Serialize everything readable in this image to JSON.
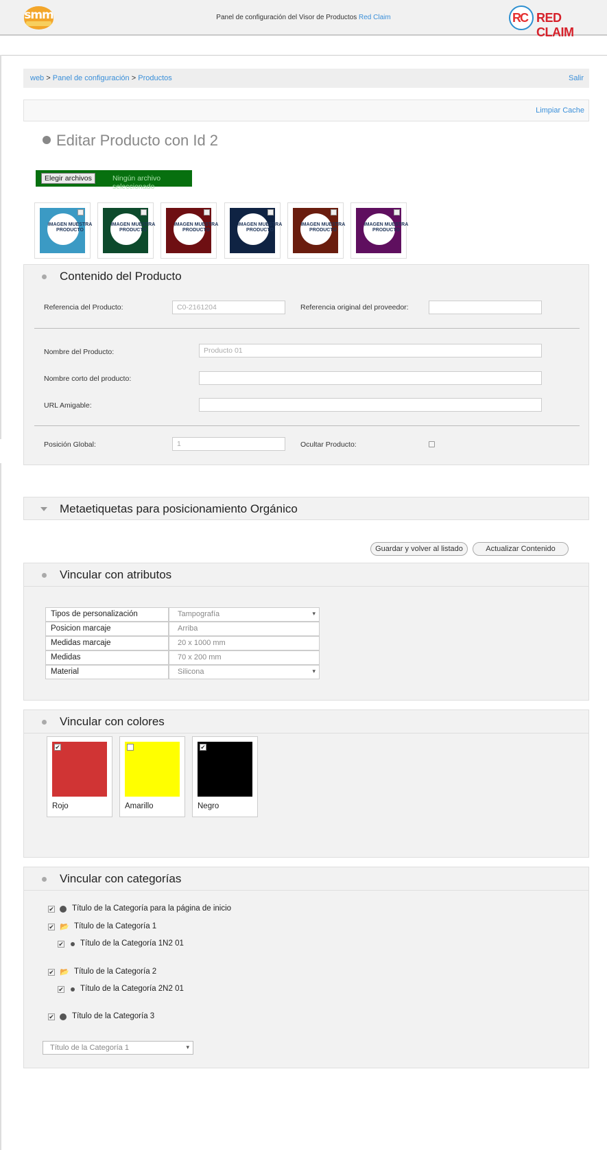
{
  "header": {
    "left_logo": "smm",
    "title_prefix": "Panel de configuración del Visor de Productos",
    "title_link": "Red Claim",
    "right_logo_text": "RED CLAIM"
  },
  "breadcrumb": {
    "items": [
      "web",
      "Panel de configuración",
      "Productos"
    ],
    "separator": ">",
    "logout": "Salir"
  },
  "cache": {
    "label": "Limpiar Cache"
  },
  "page": {
    "title": "Editar Producto con Id 2"
  },
  "file": {
    "button": "Elegir archivos",
    "status": "Ningún archivo seleccionado"
  },
  "thumbnails": [
    {
      "caption": "IMAGEN MUESTRA PRODUCTO",
      "color": "#3b9ac4"
    },
    {
      "caption": "IMAGEN MUESTRA PRODUCTO",
      "color": "#0d4a2c"
    },
    {
      "caption": "IMAGEN MUESTRA PRODUCTO",
      "color": "#6e0f12"
    },
    {
      "caption": "IMAGEN MUESTRA PRODUCTO",
      "color": "#0f2343"
    },
    {
      "caption": "IMAGEN MUESTRA PRODUCTO",
      "color": "#6a1d0e"
    },
    {
      "caption": "IMAGEN MUESTRA PRODUCTO",
      "color": "#5f0f5f"
    }
  ],
  "content": {
    "heading": "Contenido del Producto",
    "ref_label": "Referencia del Producto:",
    "ref_value": "C0-2161204",
    "orig_ref_label": "Referencia original del proveedor:",
    "orig_ref_value": "",
    "name_label": "Nombre del Producto:",
    "name_value": "Producto 01",
    "short_name_label": "Nombre corto del producto:",
    "short_name_value": "",
    "url_label": "URL Amigable:",
    "url_value": "",
    "position_label": "Posición Global:",
    "position_value": "1",
    "hide_label": "Ocultar Producto:"
  },
  "meta": {
    "heading": "Metaetiquetas para posicionamiento Orgánico"
  },
  "actions": {
    "save_back": "Guardar y volver al listado",
    "update": "Actualizar Contenido"
  },
  "attributes": {
    "heading": "Vincular con atributos",
    "rows": [
      {
        "key": "Tipos de personalización",
        "value": "Tampografía",
        "select": true
      },
      {
        "key": "Posicion marcaje",
        "value": "Arriba",
        "select": false
      },
      {
        "key": "Medidas marcaje",
        "value": "20 x 1000 mm",
        "select": false
      },
      {
        "key": "Medidas",
        "value": "70 x 200 mm",
        "select": false
      },
      {
        "key": "Material",
        "value": "Silicona",
        "select": true
      }
    ]
  },
  "colors": {
    "heading": "Vincular con colores",
    "items": [
      {
        "name": "Rojo",
        "swatch": "#d03434",
        "checked": true
      },
      {
        "name": "Amarillo",
        "swatch": "#ffff00",
        "checked": false
      },
      {
        "name": "Negro",
        "swatch": "#000000",
        "checked": true
      }
    ]
  },
  "categories": {
    "heading": "Vincular con categorías",
    "items": [
      {
        "label": "Título de la Categoría para la página de inicio"
      },
      {
        "label": "Título de la Categoría 1"
      },
      {
        "label": "Título de la Categoría 1N2 01"
      },
      {
        "label": "Título de la Categoría 2"
      },
      {
        "label": "Título de la Categoría 2N2 01"
      },
      {
        "label": "Título de la Categoría 3"
      }
    ],
    "select_value": "Título de la Categoría 1"
  }
}
